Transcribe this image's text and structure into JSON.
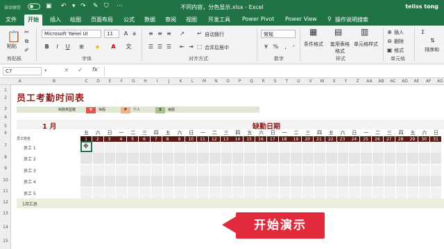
{
  "titlebar": {
    "autosave": "自动保存",
    "filename": "不同内容，分色显示.xlsx - Excel",
    "user": "teliss tong"
  },
  "tabs": [
    "文件",
    "开始",
    "插入",
    "绘图",
    "页面布局",
    "公式",
    "数据",
    "审阅",
    "视图",
    "开发工具",
    "Power Pivot",
    "Power View",
    "操作说明搜索"
  ],
  "ribbon": {
    "paste": "粘贴",
    "clipboard": "剪贴板",
    "font_name": "Microsoft YaHei UI",
    "font_size": "11",
    "font_group": "字体",
    "wrap_text": "自动换行",
    "merge_center": "合并后居中",
    "align_group": "对齐方式",
    "number_format": "常规",
    "number_group": "数字",
    "cond_format": "条件格式",
    "table_format": "套用表格格式",
    "cell_styles": "单元格样式",
    "styles_group": "样式",
    "insert": "插入",
    "delete": "删除",
    "format": "格式",
    "cells_group": "单元格",
    "sort": "排序和"
  },
  "formula_bar": {
    "name_box": "C7",
    "fx": "fx"
  },
  "columns": [
    "A",
    "B",
    "C",
    "D",
    "E",
    "F",
    "G",
    "H",
    "I",
    "J",
    "K",
    "L",
    "M",
    "N",
    "O",
    "P",
    "Q",
    "R",
    "S",
    "T",
    "U",
    "V",
    "W",
    "X",
    "Y",
    "Z",
    "AA",
    "AB",
    "AC",
    "AD",
    "AE",
    "AF",
    "AG"
  ],
  "rows": [
    "1",
    "2",
    "3",
    "4",
    "5",
    "6",
    "7",
    "8",
    "9",
    "10",
    "11",
    "12",
    "13",
    "14",
    "15"
  ],
  "sheet": {
    "title": "员工考勤时间表",
    "legend_key": "缺勤类型键",
    "legend": [
      {
        "code": "V",
        "label": "休假",
        "color": "#e8524a"
      },
      {
        "code": "P",
        "label": "个人",
        "color": "#f4b183"
      },
      {
        "code": "S",
        "label": "病假",
        "color": "#a9c08a"
      }
    ],
    "month": "1 月",
    "absence_dates": "缺勤日期",
    "weekdays": [
      "五",
      "六",
      "日",
      "一",
      "二",
      "三",
      "四",
      "五",
      "六",
      "日",
      "一",
      "二",
      "三",
      "四",
      "五",
      "六",
      "日",
      "一",
      "二",
      "三",
      "四",
      "五",
      "六",
      "日",
      "一",
      "二",
      "三",
      "四",
      "五",
      "六",
      "日"
    ],
    "days": [
      "1",
      "2",
      "3",
      "4",
      "5",
      "6",
      "7",
      "8",
      "9",
      "10",
      "11",
      "12",
      "13",
      "14",
      "15",
      "16",
      "17",
      "18",
      "19",
      "20",
      "21",
      "22",
      "23",
      "24",
      "25",
      "26",
      "27",
      "28",
      "29",
      "30",
      "31"
    ],
    "employee_header": "员工姓名",
    "employees": [
      "员工 1",
      "员工 2",
      "员工 3",
      "员工 4",
      "员工 5"
    ],
    "summary": "1月汇总"
  },
  "callout": "开始演示"
}
